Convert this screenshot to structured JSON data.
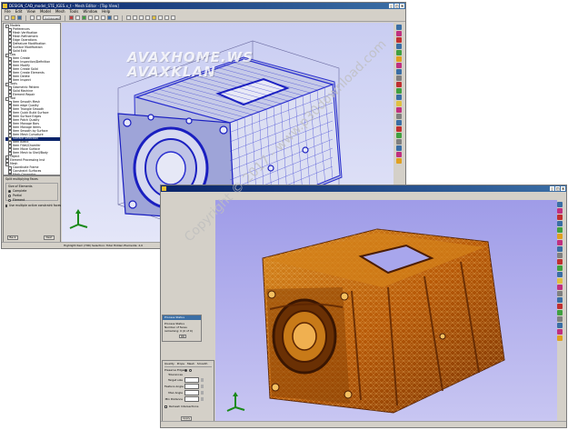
{
  "window1": {
    "title": "DESIGN_CAD_model_STE_IGES.x_t - Mesh Editor - [Top View]",
    "menu": [
      "File",
      "Edit",
      "View",
      "Model",
      "Mesh",
      "Tools",
      "Window",
      "Help"
    ],
    "toolbar_select": "Component",
    "tree": [
      {
        "label": "Models",
        "level": 0
      },
      {
        "label": "Preferences",
        "level": 1
      },
      {
        "label": "Mesh Verification",
        "level": 1
      },
      {
        "label": "Mesh Refinement",
        "level": 1
      },
      {
        "label": "Edge Operations",
        "level": 1
      },
      {
        "label": "Defeature Modification",
        "level": 1
      },
      {
        "label": "Surface Modification",
        "level": 1
      },
      {
        "label": "Solid Edit",
        "level": 1
      },
      {
        "label": "Ops",
        "level": 0
      },
      {
        "label": "Item Create",
        "level": 1
      },
      {
        "label": "Item Inspection/Definition",
        "level": 1
      },
      {
        "label": "Item Modify",
        "level": 1
      },
      {
        "label": "Item Create Solid",
        "level": 1
      },
      {
        "label": "Item Create Elements",
        "level": 1
      },
      {
        "label": "Item Delete",
        "level": 1
      },
      {
        "label": "Item Inspect",
        "level": 1
      },
      {
        "label": "Tools",
        "level": 0
      },
      {
        "label": "Geometric Pattern",
        "level": 1
      },
      {
        "label": "Solid Machine",
        "level": 1
      },
      {
        "label": "Element Repair",
        "level": 1
      },
      {
        "label": "Tool",
        "level": 0
      },
      {
        "label": "Item Smooth Mesh",
        "level": 1
      },
      {
        "label": "Item edge Quality",
        "level": 1
      },
      {
        "label": "Item Triangle Smooth",
        "level": 1
      },
      {
        "label": "Item Quick Build Surface",
        "level": 1
      },
      {
        "label": "Item Surface Edges",
        "level": 1
      },
      {
        "label": "Item Patch Quality",
        "level": 1
      },
      {
        "label": "Item Manage Bars",
        "level": 1
      },
      {
        "label": "Item Manage Items",
        "level": 1
      },
      {
        "label": "Item Smooth by Surface",
        "level": 1
      },
      {
        "label": "Item Mesh Curvature",
        "level": 1
      },
      {
        "label": "Surface Selection",
        "level": 1,
        "selected": true
      },
      {
        "label": "Item Blend",
        "level": 1
      },
      {
        "label": "Item Fillet/Chamfer",
        "level": 1
      },
      {
        "label": "Item Move Surface",
        "level": 1
      },
      {
        "label": "Item Mesh to Shell/Body",
        "level": 1
      },
      {
        "label": "Object",
        "level": 0
      },
      {
        "label": "Element Processing Inst",
        "level": 0
      },
      {
        "label": "Mesh",
        "level": 0
      },
      {
        "label": "Coordinate Frame",
        "level": 1
      },
      {
        "label": "Constraint Surfaces",
        "level": 1
      },
      {
        "label": "Mesh Generator",
        "level": 1
      },
      {
        "label": "Solid Mesh",
        "level": 1
      },
      {
        "label": "Sample Items",
        "level": 1
      }
    ],
    "props": {
      "header": "Split multiplying Faces",
      "group_title": "Size of Elements",
      "radios": [
        "Complete",
        "Partial",
        "Element"
      ],
      "checkbox": "Use multiple active constraint faces",
      "buttons": [
        "Back",
        "Next"
      ]
    },
    "status": "Highlight Item (HID)     Selection: Total     Hidden Elements: 2,0"
  },
  "window2": {
    "message_dialog": {
      "title": "Process Status",
      "lines": [
        "Process Status",
        "Number of faces remaining: 0 (0 of 0)"
      ],
      "ok": "OK"
    },
    "control_panel": {
      "tabs": [
        "Quality",
        "Props",
        "Mesh",
        "Smooth"
      ],
      "rows": [
        {
          "label": "Preserve Edges"
        },
        {
          "label": "Tolerances"
        },
        {
          "label": "Target size"
        },
        {
          "label": "Feature Angle"
        },
        {
          "label": "Max Angle"
        },
        {
          "label": "Min Distance"
        }
      ],
      "checkbox": "Remesh Intersections",
      "button": "Apply"
    }
  },
  "watermark": [
    "AVAXHOME.WS",
    "AVAXKLAN"
  ],
  "copyright": "Copyright © 2017 - www.p30download.com",
  "copyright2": "www.p30download.com",
  "colors": {
    "title_bar": "#0a246a",
    "viewport1_bg": "#c9cdf2",
    "viewport2_bg": "#9f9ce8",
    "wire_model": "#2a2fd0",
    "shaded_model": "#c46a10",
    "tree_selection": "#0a246a"
  },
  "icons": [
    "minimize-icon",
    "maximize-icon",
    "close-icon",
    "axis-triad-icon",
    "folder-icon",
    "save-icon"
  ]
}
